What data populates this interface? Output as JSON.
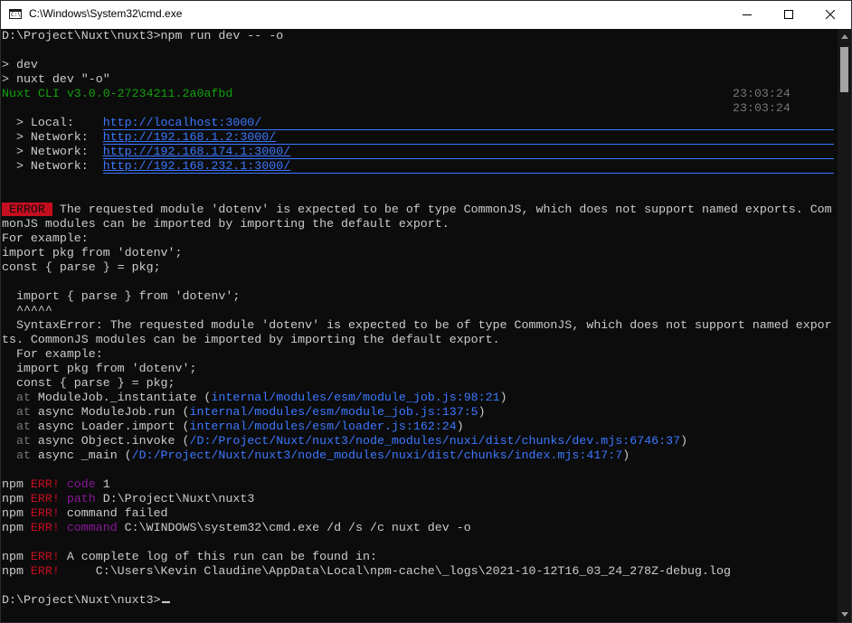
{
  "window": {
    "title": "C:\\Windows\\System32\\cmd.exe",
    "icon": "cmd-icon"
  },
  "colors": {
    "error": "#c50f1f",
    "link": "#3b78ff",
    "success": "#13a10e",
    "dim": "#767676",
    "magenta": "#881798"
  },
  "console": {
    "command_line": "D:\\Project\\Nuxt\\nuxt3>npm run dev -- -o",
    "script_name": "> dev",
    "script_cmd": "> nuxt dev \"-o\"",
    "nuxt_version": "Nuxt CLI v3.0.0-27234211.2a0afbd",
    "timestamps": [
      "23:03:24",
      "23:03:24"
    ],
    "servers": [
      {
        "label": "  > Local:    ",
        "url": "http://localhost:3000/"
      },
      {
        "label": "  > Network:  ",
        "url": "http://192.168.1.2:3000/"
      },
      {
        "label": "  > Network:  ",
        "url": "http://192.168.174.1:3000/"
      },
      {
        "label": "  > Network:  ",
        "url": "http://192.168.232.1:3000/"
      }
    ],
    "error_badge": " ERROR ",
    "error_msg_1": " The requested module 'dotenv' is expected to be of type CommonJS, which does not support named exports. Com",
    "error_msg_2": "monJS modules can be imported by importing the default export.",
    "example_1": "For example:",
    "example_2": "import pkg from 'dotenv';",
    "example_3": "const { parse } = pkg;",
    "source_line": "  import { parse } from 'dotenv';",
    "caret_line": "  ^^^^^",
    "syntax_error_1": "  SyntaxError: The requested module 'dotenv' is expected to be of type CommonJS, which does not support named expor",
    "syntax_error_2": "ts. CommonJS modules can be imported by importing the default export.",
    "indent_example_1": "  For example:",
    "indent_example_2": "  import pkg from 'dotenv';",
    "indent_example_3": "  const { parse } = pkg;",
    "stack": [
      {
        "at": "  at",
        "fn": " ModuleJob._instantiate (",
        "loc": "internal/modules/esm/module_job.js:98:21",
        "end": ")"
      },
      {
        "at": "  at",
        "fn": " async ModuleJob.run (",
        "loc": "internal/modules/esm/module_job.js:137:5",
        "end": ")"
      },
      {
        "at": "  at",
        "fn": " async Loader.import (",
        "loc": "internal/modules/esm/loader.js:162:24",
        "end": ")"
      },
      {
        "at": "  at",
        "fn": " async Object.invoke (",
        "loc": "/D:/Project/Nuxt/nuxt3/node_modules/nuxi/dist/chunks/dev.mjs:6746:37",
        "end": ")"
      },
      {
        "at": "  at",
        "fn": " async _main (",
        "loc": "/D:/Project/Nuxt/nuxt3/node_modules/nuxi/dist/chunks/index.mjs:417:7",
        "end": ")"
      }
    ],
    "npm_lines": [
      {
        "prefix": "npm ",
        "err": "ERR!",
        "key": " code",
        "val": " 1"
      },
      {
        "prefix": "npm ",
        "err": "ERR!",
        "key": " path",
        "val": " D:\\Project\\Nuxt\\nuxt3"
      },
      {
        "prefix": "npm ",
        "err": "ERR!",
        "key": "",
        "val": " command failed"
      },
      {
        "prefix": "npm ",
        "err": "ERR!",
        "key": " command",
        "val": " C:\\WINDOWS\\system32\\cmd.exe /d /s /c nuxt dev -o"
      }
    ],
    "npm_log": [
      {
        "prefix": "npm ",
        "err": "ERR!",
        "val": " A complete log of this run can be found in:"
      },
      {
        "prefix": "npm ",
        "err": "ERR!",
        "val": "     C:\\Users\\Kevin Claudine\\AppData\\Local\\npm-cache\\_logs\\2021-10-12T16_03_24_278Z-debug.log"
      }
    ],
    "prompt": "D:\\Project\\Nuxt\\nuxt3>"
  }
}
